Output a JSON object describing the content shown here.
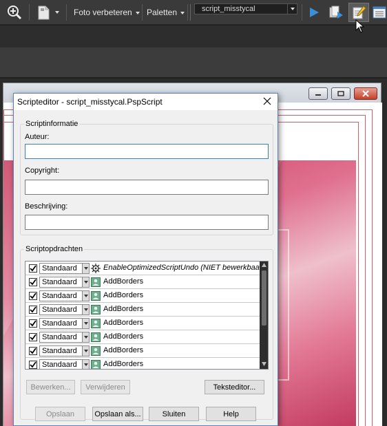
{
  "toolbar": {
    "foto_verbeteren": "Foto verbeteren",
    "paletten": "Paletten",
    "script_value": "script_misstycal"
  },
  "dialog": {
    "title": "Scripteditor - script_misstycal.PspScript",
    "info_group": "Scriptinformatie",
    "auteur_label": "Auteur:",
    "copyright_label": "Copyright:",
    "beschrijving_label": "Beschrijving:",
    "auteur_value": "",
    "copyright_value": "",
    "beschrijving_value": "",
    "commands_group": "Scriptopdrachten",
    "commands": [
      {
        "checked": true,
        "mode": "Standaard",
        "name": "EnableOptimizedScriptUndo (NIET bewerkbaar)",
        "icon": "gear-icon",
        "editable": false
      },
      {
        "checked": true,
        "mode": "Standaard",
        "name": "AddBorders",
        "icon": "user-icon",
        "editable": true
      },
      {
        "checked": true,
        "mode": "Standaard",
        "name": "AddBorders",
        "icon": "user-icon",
        "editable": true
      },
      {
        "checked": true,
        "mode": "Standaard",
        "name": "AddBorders",
        "icon": "user-icon",
        "editable": true
      },
      {
        "checked": true,
        "mode": "Standaard",
        "name": "AddBorders",
        "icon": "user-icon",
        "editable": true
      },
      {
        "checked": true,
        "mode": "Standaard",
        "name": "AddBorders",
        "icon": "user-icon",
        "editable": true
      },
      {
        "checked": true,
        "mode": "Standaard",
        "name": "AddBorders",
        "icon": "user-icon",
        "editable": true
      },
      {
        "checked": true,
        "mode": "Standaard",
        "name": "AddBorders",
        "icon": "user-icon",
        "editable": true
      }
    ],
    "bewerken": "Bewerken...",
    "verwijderen": "Verwijderen",
    "teksteditor": "Teksteditor...",
    "opslaan": "Opslaan",
    "opslaan_als": "Opslaan als...",
    "sluiten": "Sluiten",
    "help": "Help"
  }
}
